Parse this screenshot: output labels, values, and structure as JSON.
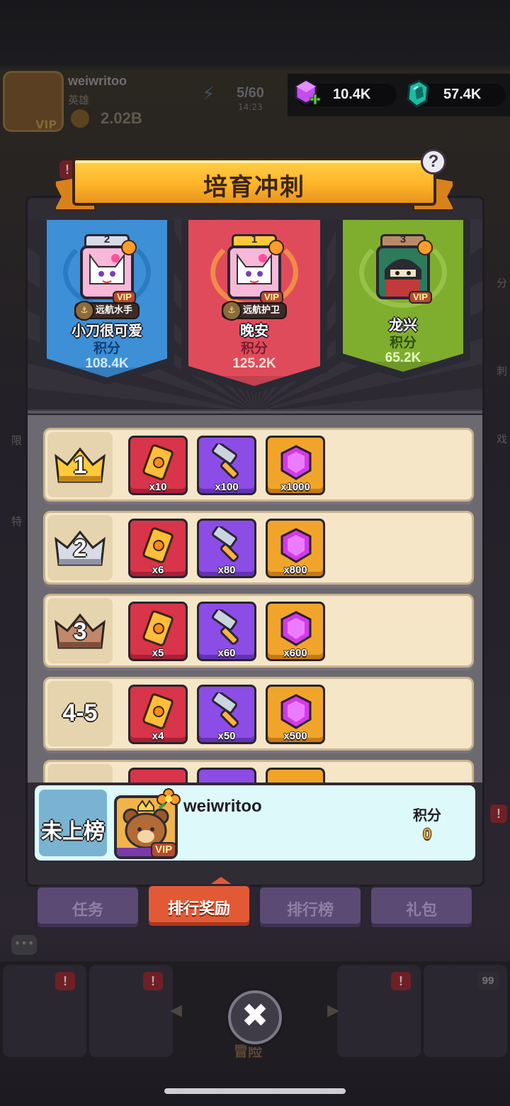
{
  "background": {
    "profile_name": "weiwritoo",
    "profile_title": "英雄",
    "power": "2.02B",
    "avatar_vip": "VIP",
    "energy": "5/60",
    "energy_timer": "14:23",
    "adventure_label": "冒险",
    "side_left": [
      "限",
      "特"
    ],
    "side_right": [
      "分",
      "刺",
      "戏"
    ],
    "badge_count": "99",
    "badge_alert": "!"
  },
  "currency": {
    "gems": "10.4K",
    "crystals": "57.4K",
    "gems_icon": "purple-gem-plus-icon",
    "crystals_icon": "teal-crystal-icon"
  },
  "panel": {
    "title": "培育冲刺",
    "help_label": "?"
  },
  "podium": [
    {
      "rank": "2",
      "name": "小刀很可爱",
      "title": "远航水手",
      "score_label": "积分",
      "score": "108.4K",
      "vip": "VIP",
      "color": "#3d8fd6"
    },
    {
      "rank": "1",
      "name": "晚安",
      "title": "远航护卫",
      "score_label": "积分",
      "score": "125.2K",
      "vip": "VIP",
      "color": "#e04b5b"
    },
    {
      "rank": "3",
      "name": "龙兴",
      "score_label": "积分",
      "score": "65.2K",
      "vip": "VIP",
      "color": "#7fae2e"
    }
  ],
  "rewards": [
    {
      "rank": "1",
      "items": [
        "x10",
        "x100",
        "x1000"
      ]
    },
    {
      "rank": "2",
      "items": [
        "x6",
        "x80",
        "x800"
      ]
    },
    {
      "rank": "3",
      "items": [
        "x5",
        "x60",
        "x600"
      ]
    },
    {
      "rank": "4-5",
      "items": [
        "x4",
        "x50",
        "x500"
      ]
    }
  ],
  "reward_item_types": [
    "ticket-icon",
    "hammer-icon",
    "gem-icon"
  ],
  "me": {
    "rank": "未上榜",
    "name": "weiwritoo",
    "score_label": "积分",
    "score": "0",
    "vip": "VIP"
  },
  "tabs": [
    {
      "label": "任务",
      "active": false
    },
    {
      "label": "排行奖励",
      "active": true
    },
    {
      "label": "排行榜",
      "active": false
    },
    {
      "label": "礼包",
      "active": false
    }
  ],
  "close_label": "✖"
}
